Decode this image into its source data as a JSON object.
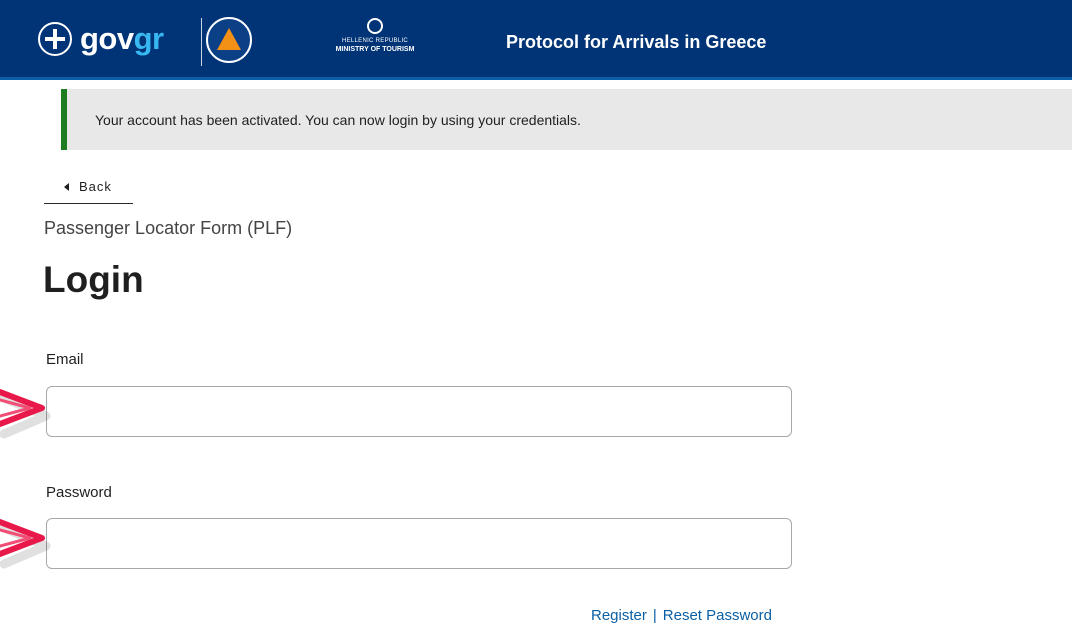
{
  "header": {
    "logo_text_gov": "gov",
    "logo_text_gr": "gr",
    "ministry_line1": "HELLENIC REPUBLIC",
    "ministry_line2": "MINISTRY OF TOURISM",
    "title": "Protocol for Arrivals in Greece"
  },
  "alert": {
    "message": "Your account has been activated. You can now login by using your credentials.",
    "accent_color": "#1e7d21"
  },
  "nav": {
    "back_label": "Back"
  },
  "form": {
    "caption": "Passenger Locator Form (PLF)",
    "title": "Login",
    "email_label": "Email",
    "email_value": "",
    "password_label": "Password",
    "password_value": ""
  },
  "links": {
    "register": "Register",
    "separator": "|",
    "reset_password": "Reset Password"
  },
  "colors": {
    "header_bg": "#003476",
    "link": "#0b5fa5",
    "annotation_arrow": "#e8194a"
  },
  "icons": [
    "gov-emblem-icon",
    "civil-protection-logo-icon",
    "ministry-seal-icon",
    "caret-left-icon",
    "annotation-arrow-icon"
  ]
}
